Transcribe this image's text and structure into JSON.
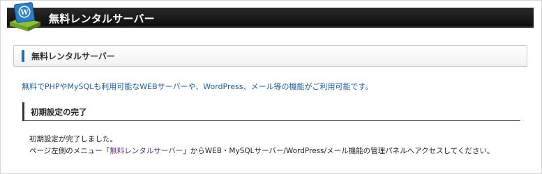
{
  "header": {
    "title": "無料レンタルサーバー",
    "logo_icon": "wordpress-server-icon"
  },
  "section": {
    "title": "無料レンタルサーバー"
  },
  "intro": "無料でPHPやMySQLも利用可能なWEBサーバーや、WordPress、メール等の機能がご利用可能です。",
  "subsection": {
    "title": "初期設定の完了"
  },
  "message": {
    "line1": "初期設定が完了しました。",
    "line2_prefix": "ページ左側のメニュー「",
    "line2_link": "無料レンタルサーバー",
    "line2_suffix": "」からWEB・MySQLサーバー/WordPress/メール機能の管理パネルへアクセスしてください。"
  },
  "colors": {
    "accent": "#1d6fb8",
    "intro_text": "#1a5fa8",
    "link": "#5b2a8a",
    "header_bar": "#111111"
  }
}
